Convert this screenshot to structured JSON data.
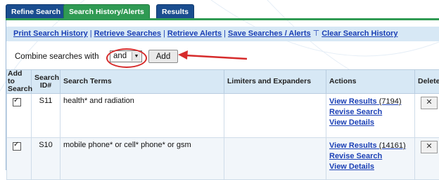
{
  "tabs": [
    {
      "label": "Refine Search",
      "active": false
    },
    {
      "label": "Search History/Alerts",
      "active": true
    },
    {
      "label": "Results",
      "active": false
    }
  ],
  "links": {
    "print": "Print Search History",
    "retrieve_searches": "Retrieve Searches",
    "retrieve_alerts": "Retrieve Alerts",
    "save": "Save Searches / Alerts",
    "clear": "Clear Search History",
    "separator": "|"
  },
  "combine": {
    "label": "Combine searches with",
    "selected": "and",
    "add_label": "Add"
  },
  "table": {
    "headers": {
      "add": "Add to Search",
      "id": "Search ID#",
      "terms": "Search Terms",
      "limiters": "Limiters and Expanders",
      "actions": "Actions",
      "delete": "Delete"
    },
    "rows": [
      {
        "id": "S11",
        "terms": "health* and radiation",
        "limiters": "",
        "view_results": "View Results",
        "count": "(7194)",
        "revise": "Revise Search",
        "details": "View Details",
        "delete": "✕"
      },
      {
        "id": "S10",
        "terms": "mobile phone* or cell* phone* or gsm",
        "limiters": "",
        "view_results": "View Results",
        "count": "(14161)",
        "revise": "Revise Search",
        "details": "View Details",
        "delete": "✕"
      }
    ]
  },
  "colors": {
    "tab_active": "#2f9a53",
    "tab_inactive": "#1a4d8f",
    "link": "#1a3fb5",
    "header_bg": "#d7e8f5",
    "annotation": "#d62b2b"
  }
}
